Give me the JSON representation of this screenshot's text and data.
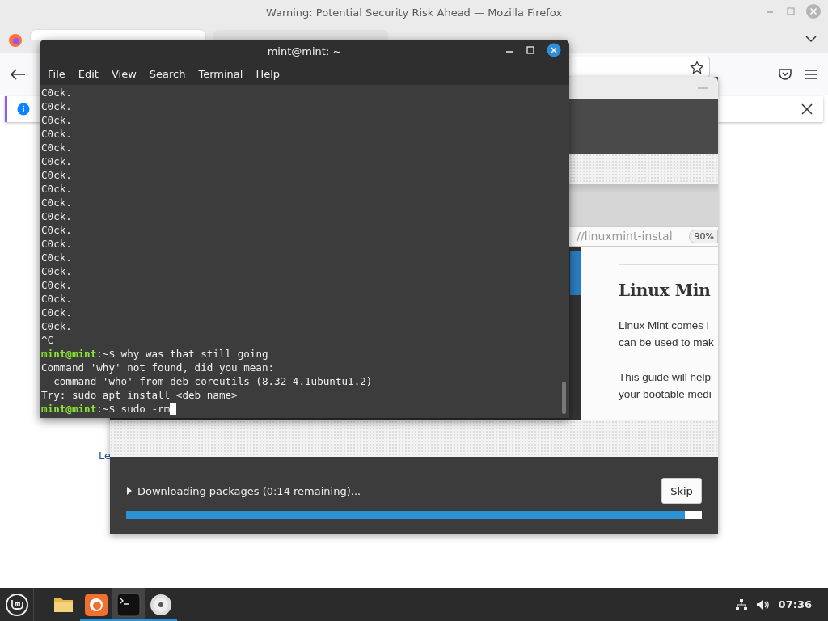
{
  "browser": {
    "title": "Warning: Potential Security Risk Ahead — Mozilla Firefox",
    "tabs": [
      {
        "selected": true
      },
      {
        "selected": false
      }
    ],
    "page_link": "Le"
  },
  "installer": {
    "slide": {
      "url": "//linuxmint-instal",
      "zoom": "90%",
      "heading": "Linux Min",
      "paragraphs": [
        [
          "Linux Mint comes i",
          "can be used to mak"
        ],
        [
          "This guide will help",
          "your bootable medi"
        ]
      ]
    },
    "status": "Downloading packages (0:14 remaining)...",
    "skip_button": "Skip",
    "progress": {
      "level": 0.97
    }
  },
  "terminal": {
    "title": "mint@mint: ~",
    "menu": [
      "File",
      "Edit",
      "View",
      "Search",
      "Terminal",
      "Help"
    ],
    "lines": [
      {
        "kind": "output",
        "text": "C0ck."
      },
      {
        "kind": "output",
        "text": "C0ck."
      },
      {
        "kind": "output",
        "text": "C0ck."
      },
      {
        "kind": "output",
        "text": "C0ck."
      },
      {
        "kind": "output",
        "text": "C0ck."
      },
      {
        "kind": "output",
        "text": "C0ck."
      },
      {
        "kind": "output",
        "text": "C0ck."
      },
      {
        "kind": "output",
        "text": "C0ck."
      },
      {
        "kind": "output",
        "text": "C0ck."
      },
      {
        "kind": "output",
        "text": "C0ck."
      },
      {
        "kind": "output",
        "text": "C0ck."
      },
      {
        "kind": "output",
        "text": "C0ck."
      },
      {
        "kind": "output",
        "text": "C0ck."
      },
      {
        "kind": "output",
        "text": "C0ck."
      },
      {
        "kind": "output",
        "text": "C0ck."
      },
      {
        "kind": "output",
        "text": "C0ck."
      },
      {
        "kind": "output",
        "text": "C0ck."
      },
      {
        "kind": "output",
        "text": "C0ck."
      },
      {
        "kind": "output",
        "text": "^C"
      },
      {
        "kind": "prompt",
        "user": "mint@mint",
        "path": ":~$",
        "command": "why was that still going",
        "cursor": false
      },
      {
        "kind": "output",
        "text": "Command 'why' not found, did you mean:"
      },
      {
        "kind": "output",
        "text": "  command 'who' from deb coreutils (8.32-4.1ubuntu1.2)"
      },
      {
        "kind": "output",
        "text": "Try: sudo apt install <deb name>"
      },
      {
        "kind": "prompt",
        "user": "mint@mint",
        "path": ":~$",
        "command": "sudo -rm",
        "cursor": true
      }
    ]
  },
  "taskbar": {
    "launchers": [
      {
        "kind": "files",
        "running": false,
        "selected": false
      },
      {
        "kind": "firefox",
        "running": true,
        "selected": false
      },
      {
        "kind": "terminal",
        "running": true,
        "selected": true
      },
      {
        "kind": "disc",
        "running": true,
        "selected": false
      }
    ],
    "clock": "07:36"
  }
}
